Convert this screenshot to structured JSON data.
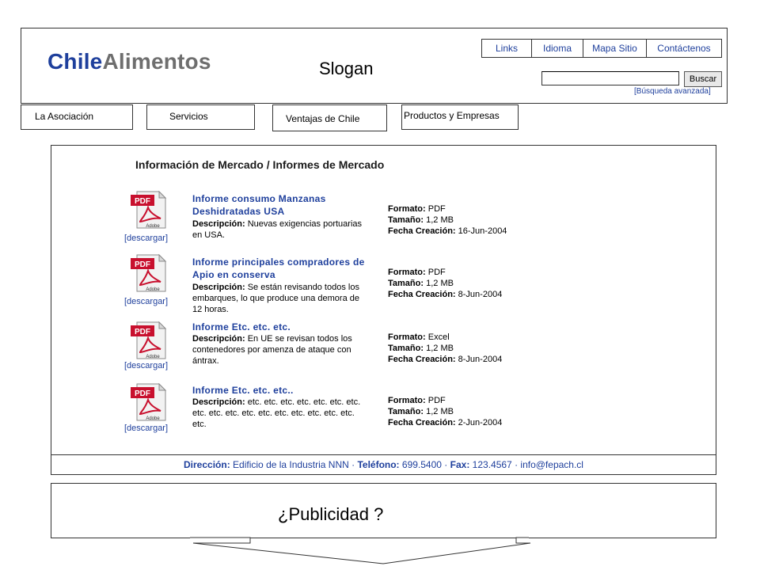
{
  "header": {
    "logo_part1": "Chile",
    "logo_part2": "Alimentos",
    "slogan": "Slogan",
    "top_links": [
      "Links",
      "Idioma",
      "Mapa Sitio",
      "Contáctenos"
    ],
    "search": {
      "value": "",
      "button_label": "Buscar",
      "advanced_link": "[Búsqueda avanzada]"
    }
  },
  "nav": {
    "tabs": [
      "La Asociación",
      "Servicios",
      "Ventajas de Chile",
      "Productos y Empresas"
    ]
  },
  "main": {
    "section_title": "Información de Mercado / Informes de Mercado",
    "download_label": "[descargar]",
    "labels": {
      "description": "Descripción:",
      "format": "Formato:",
      "size": "Tamaño:",
      "created": "Fecha Creación:"
    },
    "reports": [
      {
        "title": "Informe consumo Manzanas Deshidratadas  USA",
        "description": "Nuevas exigencias portuarias en USA.",
        "format": "PDF",
        "size": "1,2 MB",
        "created": "16-Jun-2004",
        "icon": "pdf-file-icon"
      },
      {
        "title": "Informe principales compradores de Apio en  conserva",
        "description": "Se están revisando todos los embarques, lo que produce una demora de 12 horas.",
        "format": "PDF",
        "size": "1,2 MB",
        "created": "8-Jun-2004",
        "icon": "pdf-file-icon"
      },
      {
        "title": "Informe Etc. etc.  etc.",
        "description": "En UE se revisan todos los contenedores por amenza de ataque con ántrax.",
        "format": "Excel",
        "size": "1,2 MB",
        "created": "8-Jun-2004",
        "icon": "pdf-file-icon"
      },
      {
        "title": "Informe Etc. etc. etc..",
        "description": "etc. etc. etc. etc. etc. etc. etc. etc. etc. etc. etc. etc. etc. etc. etc. etc. etc. etc.",
        "format": "PDF",
        "size": "1,2 MB",
        "created": "2-Jun-2004",
        "icon": "pdf-file-icon"
      }
    ]
  },
  "footer": {
    "address_label": "Dirección:",
    "address": "Edificio de la Industria NNN",
    "phone_label": "Teléfono:",
    "phone": "699.5400",
    "fax_label": "Fax:",
    "fax": "123.4567",
    "email": "info@fepach.cl"
  },
  "ad": {
    "text": "¿Publicidad ?"
  },
  "colors": {
    "brand_blue": "#1e3f9c",
    "logo_gray": "#6e6e6e",
    "pdf_red": "#c8102e"
  }
}
